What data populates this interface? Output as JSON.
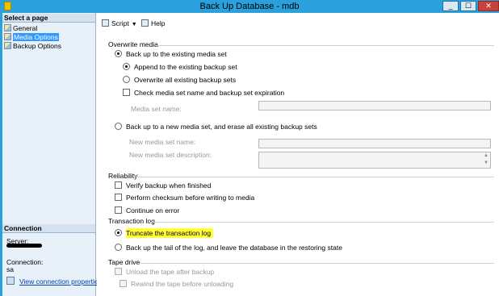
{
  "window": {
    "title": "Back Up Database - mdb",
    "minimize": "_",
    "maximize": "☐",
    "close": "✕"
  },
  "sidebar": {
    "select_page_header": "Select a page",
    "pages": [
      {
        "label": "General"
      },
      {
        "label": "Media Options"
      },
      {
        "label": "Backup Options"
      }
    ],
    "connection_header": "Connection",
    "server_label": "Server:",
    "connection_label": "Connection:",
    "connection_value": "sa",
    "view_connection_properties": "View connection properties"
  },
  "toolbar": {
    "script_label": "Script",
    "help_label": "Help"
  },
  "overwrite_media": {
    "title": "Overwrite media",
    "backup_existing_label": "Back up to the existing media set",
    "append_label": "Append to the existing backup set",
    "overwrite_all_label": "Overwrite all existing backup sets",
    "check_media_label": "Check media set name and backup set expiration",
    "media_set_name_label": "Media set name:",
    "backup_new_label": "Back up to a new media set, and erase all existing backup sets",
    "new_media_name_label": "New media set name:",
    "new_media_desc_label": "New media set description:"
  },
  "reliability": {
    "title": "Reliability",
    "verify_label": "Verify backup when finished",
    "checksum_label": "Perform checksum before writing to media",
    "continue_label": "Continue on error"
  },
  "transaction_log": {
    "title": "Transaction log",
    "truncate_label": "Truncate the transaction log",
    "tail_label": "Back up the tail of the log, and leave the database in the restoring state"
  },
  "tape_drive": {
    "title": "Tape drive",
    "unload_label": "Unload the tape after backup",
    "rewind_label": "Rewind the tape before unloading"
  },
  "colors": {
    "title_bar": "#2aa0dc",
    "selected_page": "#3399ff",
    "highlight": "#ffff33",
    "link": "#0645ad"
  }
}
